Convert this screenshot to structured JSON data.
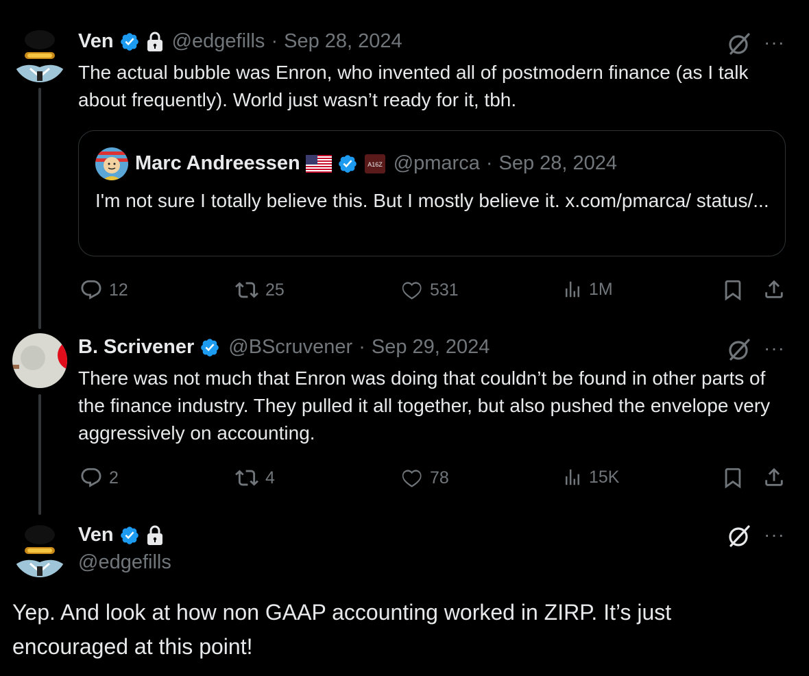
{
  "tweet1": {
    "name": "Ven",
    "handle": "@edgefills",
    "date": "Sep 28, 2024",
    "text": "The actual bubble was Enron, who invented all of postmodern finance (as I talk about frequently). World just wasn’t ready for it, tbh.",
    "quote": {
      "name": "Marc Andreessen",
      "handle": "@pmarca",
      "date": "Sep 28, 2024",
      "badge_text": "A16Z",
      "text": "I'm not sure I totally believe this. But I mostly believe it. x.com/pmarca/ status/..."
    },
    "replies": "12",
    "reposts": "25",
    "likes": "531",
    "views": "1M"
  },
  "tweet2": {
    "name": "B. Scrivener",
    "handle": "@BScruvener",
    "date": "Sep 29, 2024",
    "text": "There was not much that Enron was doing that couldn’t be found in other parts of the finance industry.  They pulled it all together, but also pushed the envelope very aggressively on accounting.",
    "replies": "2",
    "reposts": "4",
    "likes": "78",
    "views": "15K"
  },
  "tweet3": {
    "name": "Ven",
    "handle": "@edgefills",
    "text": "Yep. And look at how non GAAP accounting worked in ZIRP. It’s just encouraged at this point!"
  },
  "separator": "·",
  "more_label": "···",
  "colors": {
    "background": "#000000",
    "text": "#e7e9ea",
    "muted": "#71767b",
    "verified": "#1d9bf0",
    "border": "#2f3336"
  }
}
